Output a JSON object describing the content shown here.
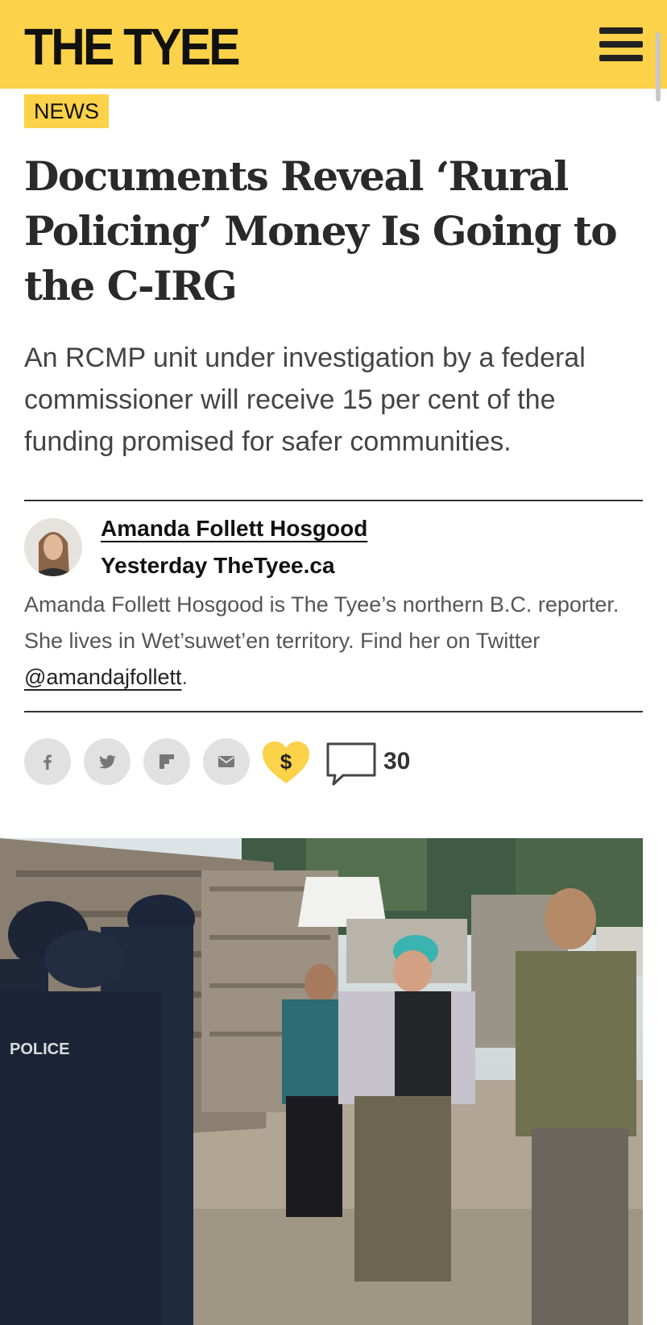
{
  "header": {
    "logo": "THE TYEE",
    "menu_icon": "hamburger-menu-icon",
    "brand_color": "#fbd249"
  },
  "article": {
    "section_tag": "NEWS",
    "title": "Documents Reveal ‘Rural Policing’ Money Is Going to the C-IRG",
    "dek": "An RCMP unit under investigation by a federal commissioner will receive 15 per cent of the funding promised for safer communities.",
    "author": "Amanda Follett Hosgood",
    "date": "Yesterday",
    "source": "TheTyee.ca",
    "bio_text": "Amanda Follett Hosgood is The Tyee’s northern B.C. reporter. She lives in Wet’suwet’en territory. Find her on Twitter ",
    "bio_handle": "@amandajfollett",
    "bio_end": "."
  },
  "share": {
    "icons": [
      "facebook-icon",
      "twitter-icon",
      "flipboard-icon",
      "email-icon",
      "support-heart-icon",
      "comment-icon"
    ],
    "support_symbol": "$",
    "comment_count": "30"
  },
  "photo": {
    "police_vest_text": "POLICE"
  }
}
